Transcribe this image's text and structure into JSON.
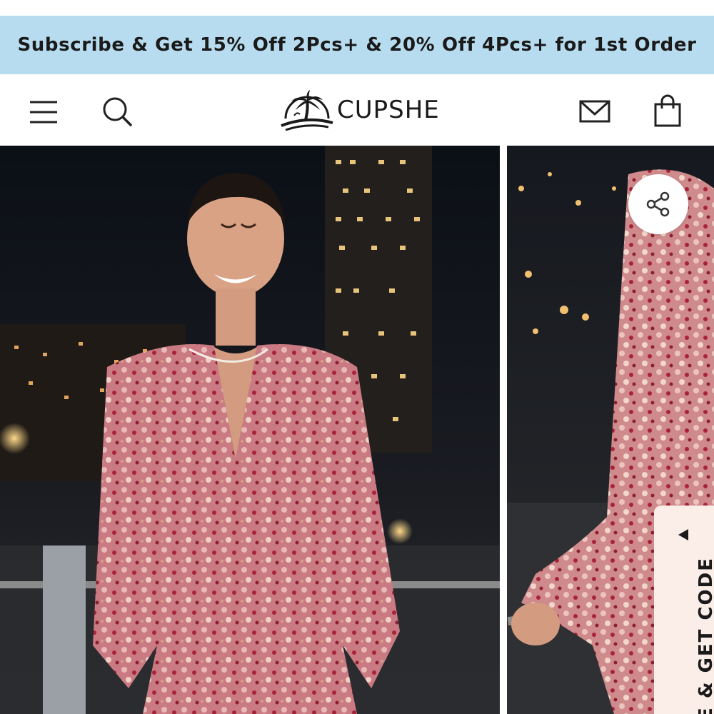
{
  "promo": {
    "text": "Subscribe & Get 15% Off 2Pcs+ & 20% Off 4Pcs+ for 1st Order",
    "background": "#b8dcef"
  },
  "header": {
    "brand": "CUPSHE",
    "icons": [
      "menu-icon",
      "search-icon",
      "mail-icon",
      "shopping-bag-icon"
    ]
  },
  "gallery": {
    "images": [
      "product-photo-main",
      "product-photo-second"
    ],
    "share_icon": "share-icon"
  },
  "code_tab": {
    "text": "E & GET CODE",
    "arrow_icon": "triangle-left-icon",
    "background": "#fbeee8"
  }
}
